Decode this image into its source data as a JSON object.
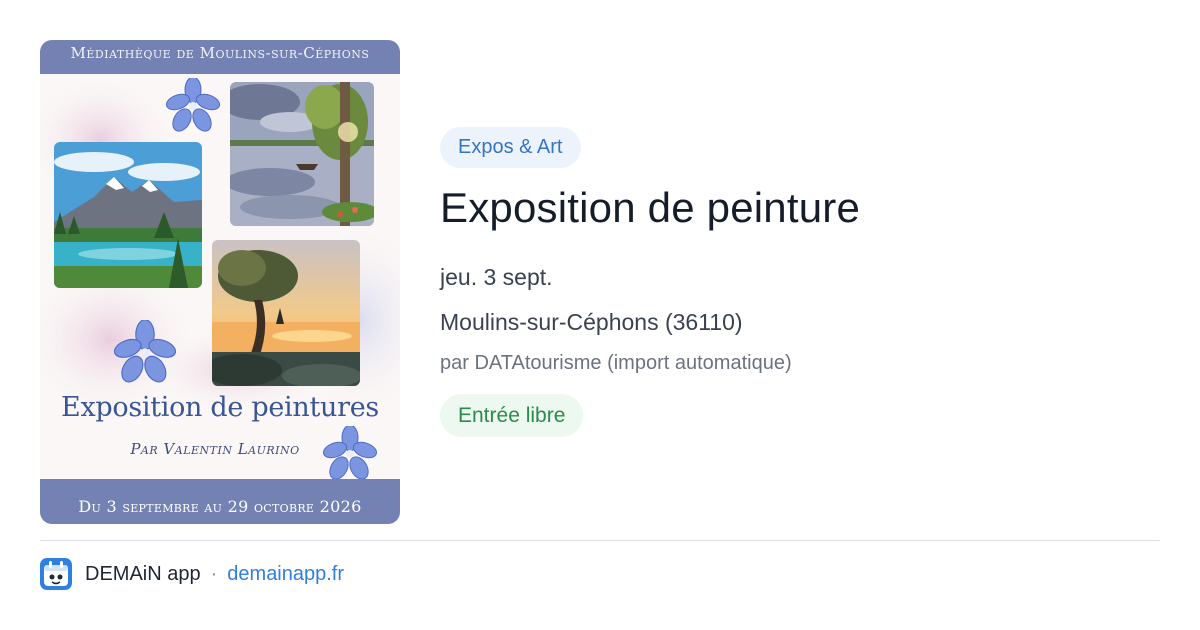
{
  "poster": {
    "venue": "Médiathèque de Moulins-sur-Céphons",
    "title": "Exposition de peintures",
    "author": "Par Valentin Laurino",
    "dates": "Du 3 septembre au 29 octobre 2026"
  },
  "event": {
    "category": "Expos & Art",
    "title": "Exposition de peinture",
    "date": "jeu. 3 sept.",
    "location": "Moulins-sur-Céphons (36110)",
    "source": "par DATAtourisme (import automatique)",
    "price": "Entrée libre"
  },
  "footer": {
    "app_name": "DEMAiN app",
    "separator": "·",
    "url": "demainapp.fr",
    "logo_icon": "demain-app-logo-icon"
  },
  "colors": {
    "accent": "#2f7fe0",
    "tag_bg": "#edf3fc",
    "tag_text": "#3474c4",
    "price_bg": "#edf8f0",
    "price_text": "#2c8a4a",
    "poster_band": "#7382b3"
  }
}
